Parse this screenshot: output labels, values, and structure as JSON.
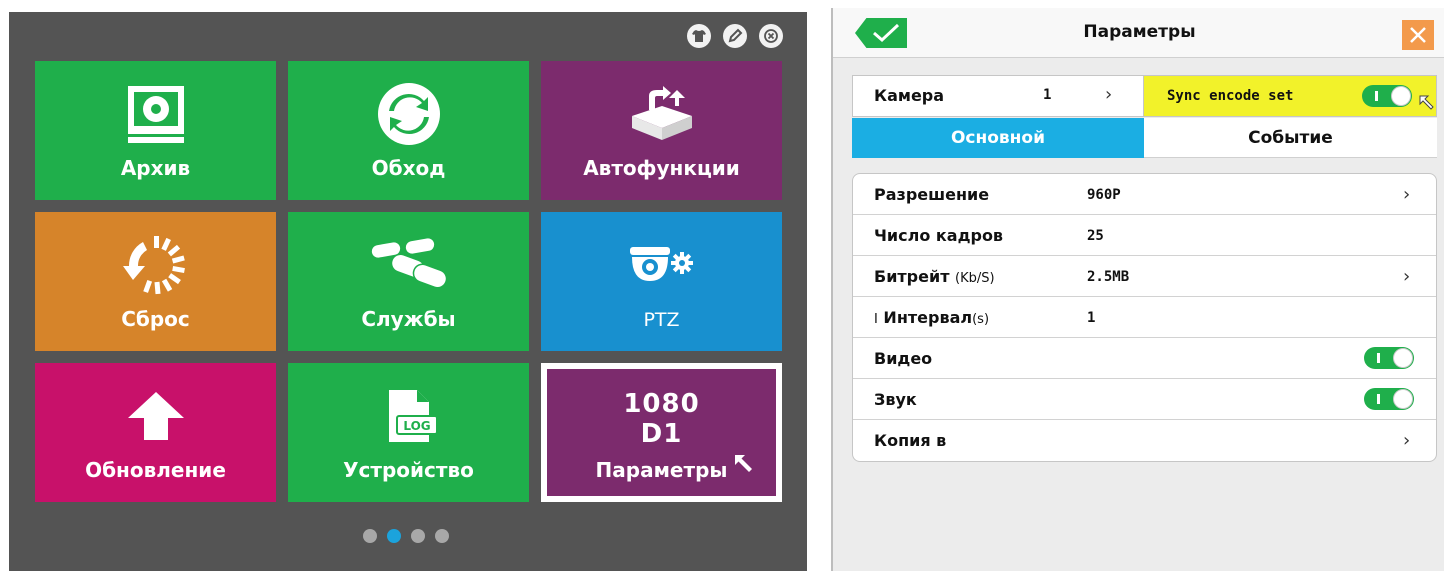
{
  "menu": {
    "tiles": [
      {
        "label": "Архив",
        "icon": "archive-icon",
        "color": "#1faf4b"
      },
      {
        "label": "Обход",
        "icon": "refresh-icon",
        "color": "#1faf4b"
      },
      {
        "label": "Автофункции",
        "icon": "auto-functions-icon",
        "color": "#7c2b6d"
      },
      {
        "label": "Сброс",
        "icon": "reset-icon",
        "color": "#d6842a"
      },
      {
        "label": "Службы",
        "icon": "binoculars-icon",
        "color": "#1faf4b"
      },
      {
        "label": "PTZ",
        "icon": "ptz-camera-icon",
        "color": "#1890cf"
      },
      {
        "label": "Обновление",
        "icon": "upload-arrow-icon",
        "color": "#c8116a"
      },
      {
        "label": "Устройство",
        "icon": "log-file-icon",
        "color": "#1faf4b"
      },
      {
        "label": "Параметры",
        "big_line1": "1080",
        "big_line2": "D1",
        "color": "#7c2b6d",
        "selected": true
      }
    ],
    "pages": 4,
    "active_page": 2
  },
  "params": {
    "title": "Параметры",
    "camera_label": "Камера",
    "camera_value": "1",
    "sync_label": "Sync encode set",
    "sync_on": true,
    "tab_main": "Основной",
    "tab_event": "Событие",
    "active_tab": "Основной",
    "rows": {
      "resolution_label": "Разрешение",
      "resolution_value": "960P",
      "fps_label": "Число кадров",
      "fps_value": "25",
      "bitrate_label": "Битрейт",
      "bitrate_unit": "(Kb/S)",
      "bitrate_value": "2.5MB",
      "interval_prefix": "I",
      "interval_label": "Интервал",
      "interval_unit": "(s)",
      "interval_value": "1",
      "video_label": "Видео",
      "video_on": true,
      "audio_label": "Звук",
      "audio_on": true,
      "copy_label": "Копия в"
    }
  },
  "colors": {
    "accent_green": "#1faf4b",
    "tab_blue": "#1baee3",
    "sync_yellow": "#f2f22a",
    "close_orange": "#f39a4b",
    "panel_dark": "#545454"
  }
}
